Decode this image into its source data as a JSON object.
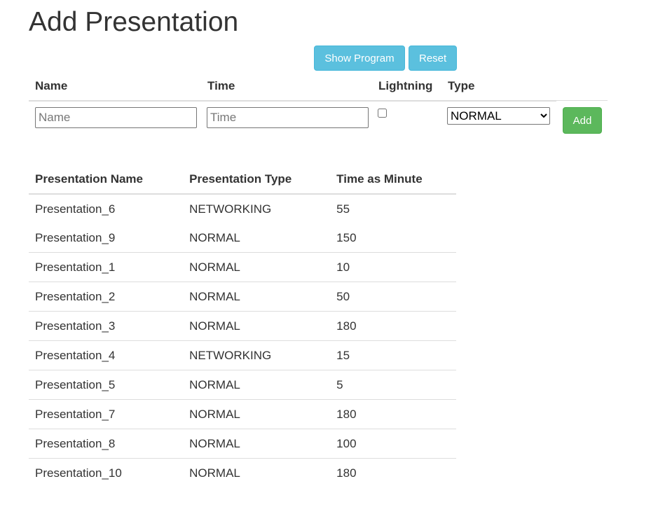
{
  "title": "Add Presentation",
  "buttons": {
    "show_program": "Show Program",
    "reset": "Reset",
    "add": "Add"
  },
  "form": {
    "headers": {
      "name": "Name",
      "time": "Time",
      "lightning": "Lightning",
      "type": "Type"
    },
    "name_placeholder": "Name",
    "time_placeholder": "Time",
    "name_value": "",
    "time_value": "",
    "lightning_checked": false,
    "type_selected": "NORMAL"
  },
  "table": {
    "columns": [
      "Presentation Name",
      "Presentation Type",
      "Time as Minute"
    ],
    "rows": [
      [
        "Presentation_6",
        "NETWORKING",
        "55"
      ],
      [
        "Presentation_9",
        "NORMAL",
        "150"
      ],
      [
        "Presentation_1",
        "NORMAL",
        "10"
      ],
      [
        "Presentation_2",
        "NORMAL",
        "50"
      ],
      [
        "Presentation_3",
        "NORMAL",
        "180"
      ],
      [
        "Presentation_4",
        "NETWORKING",
        "15"
      ],
      [
        "Presentation_5",
        "NORMAL",
        "5"
      ],
      [
        "Presentation_7",
        "NORMAL",
        "180"
      ],
      [
        "Presentation_8",
        "NORMAL",
        "100"
      ],
      [
        "Presentation_10",
        "NORMAL",
        "180"
      ]
    ]
  }
}
